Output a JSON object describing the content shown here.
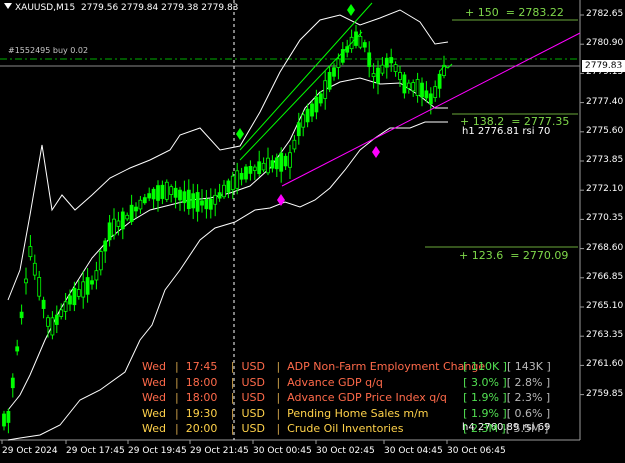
{
  "header": {
    "symbol_timeframe": "XAUUSD,M15",
    "ohlc": "2779.56 2779.84 2779.38 2779.83"
  },
  "order_label": "#1552495 buy 0.02",
  "current_price": "2779.83",
  "y_axis": [
    "2782.65",
    "2780.90",
    "2779.15",
    "2777.40",
    "2775.60",
    "2773.85",
    "2772.10",
    "2770.35",
    "2768.60",
    "2766.85",
    "2765.10",
    "2763.35",
    "2761.60",
    "2759.85"
  ],
  "x_axis": [
    "29 Oct 2024",
    "29 Oct 17:45",
    "29 Oct 19:45",
    "29 Oct 21:45",
    "30 Oct 00:45",
    "30 Oct 02:45",
    "30 Oct 04:45",
    "30 Oct 06:45"
  ],
  "fib_levels": [
    {
      "label": "+ 150",
      "value": "= 2783.22"
    },
    {
      "label": "+ 138.2",
      "value": "= 2777.35"
    },
    {
      "label": "+ 123.6",
      "value": "= 2770.09"
    }
  ],
  "rsi_labels": {
    "h1": "h1 2776.81 rsi 70",
    "h4": "h4 2760.89 rsi 69"
  },
  "news": [
    {
      "day": "Wed",
      "time": "17:45",
      "currency": "USD",
      "event": "ADP Non-Farm Employment Change",
      "forecast": "[ 110K ]",
      "previous": "[ 143K ]"
    },
    {
      "day": "Wed",
      "time": "18:00",
      "currency": "USD",
      "event": "Advance GDP q/q",
      "forecast": "[ 3.0% ]",
      "previous": "[ 2.8% ]"
    },
    {
      "day": "Wed",
      "time": "18:00",
      "currency": "USD",
      "event": "Advance GDP Price Index q/q",
      "forecast": "[ 1.9% ]",
      "previous": "[ 2.3% ]"
    },
    {
      "day": "Wed",
      "time": "19:30",
      "currency": "USD",
      "event": "Pending Home Sales m/m",
      "forecast": "[ 1.9% ]",
      "previous": "[ 0.6% ]"
    },
    {
      "day": "Wed",
      "time": "20:00",
      "currency": "USD",
      "event": "Crude Oil Inventories",
      "forecast": "[ 2.3M ]",
      "previous": "[ 5.5M ]"
    }
  ],
  "colors": {
    "bull": "#00ff00",
    "bear": "#000000",
    "bands": "#ffffff",
    "trendline": "#ff00ff",
    "fib": "#7fd84a",
    "order_line": "#00b000",
    "text": "#ffffff"
  }
}
